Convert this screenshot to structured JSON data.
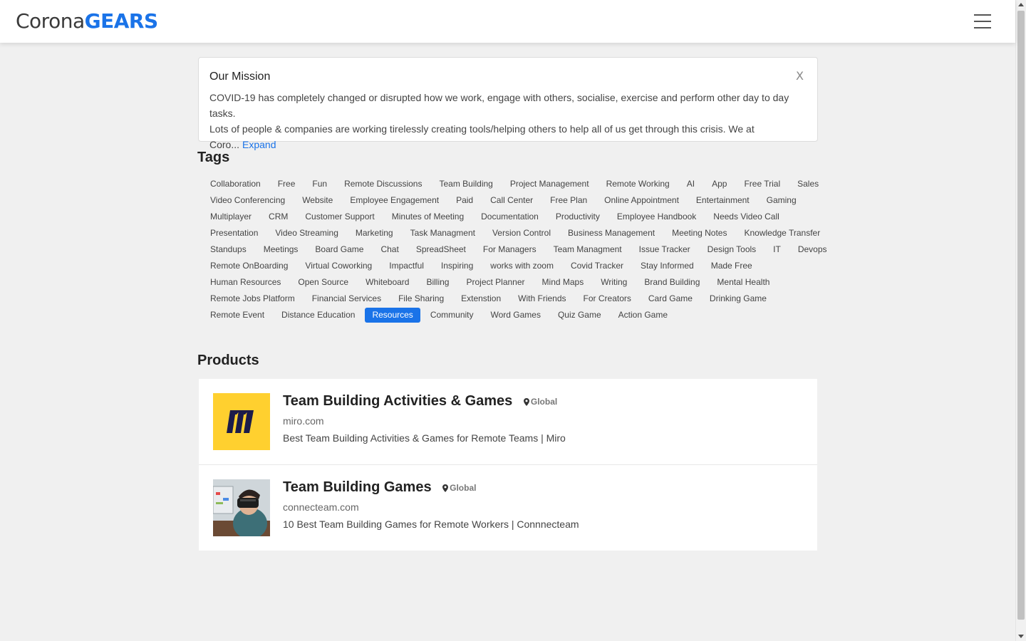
{
  "brand": {
    "part1": "Corona",
    "part2": "GEARS"
  },
  "mission": {
    "title": "Our Mission",
    "close": "X",
    "text_line1": "COVID-19 has completely changed or disrupted how we work, engage with others, socialise, exercise and perform other day to day tasks.",
    "text_line2": "Lots of people & companies are working tirelessly creating tools/helping others to help all of us get through this crisis. We at Coro...",
    "expand": "Expand"
  },
  "tags_heading": "Tags",
  "tag_rows": [
    [
      "Collaboration",
      "Free",
      "Fun",
      "Remote Discussions",
      "Team Building",
      "Project Management",
      "Remote Working",
      "AI",
      "App",
      "Free Trial",
      "Sales"
    ],
    [
      "Video Conferencing",
      "Website",
      "Employee Engagement",
      "Paid",
      "Call Center",
      "Free Plan",
      "Online Appointment",
      "Entertainment",
      "Gaming"
    ],
    [
      "Multiplayer",
      "CRM",
      "Customer Support",
      "Minutes of Meeting",
      "Documentation",
      "Productivity",
      "Employee Handbook",
      "Needs Video Call"
    ],
    [
      "Presentation",
      "Video Streaming",
      "Marketing",
      "Task Managment",
      "Version Control",
      "Business Management",
      "Meeting Notes",
      "Knowledge Transfer"
    ],
    [
      "Standups",
      "Meetings",
      "Board Game",
      "Chat",
      "SpreadSheet",
      "For Managers",
      "Team Managment",
      "Issue Tracker",
      "Design Tools",
      "IT",
      "Devops"
    ],
    [
      "Remote OnBoarding",
      "Virtual Coworking",
      "Impactful",
      "Inspiring",
      "works with zoom",
      "Covid Tracker",
      "Stay Informed",
      "Made Free"
    ],
    [
      "Human Resources",
      "Open Source",
      "Whiteboard",
      "Billing",
      "Project Planner",
      "Mind Maps",
      "Writing",
      "Brand Building",
      "Mental Health"
    ],
    [
      "Remote Jobs Platform",
      "Financial Services",
      "File Sharing",
      "Extenstion",
      "With Friends",
      "For Creators",
      "Card Game",
      "Drinking Game"
    ],
    [
      "Remote Event",
      "Distance Education",
      "Resources",
      "Community",
      "Word Games",
      "Quiz Game",
      "Action Game"
    ]
  ],
  "active_tag": "Resources",
  "products_heading": "Products",
  "products": [
    {
      "title": "Team Building Activities & Games",
      "region": "Global",
      "domain": "miro.com",
      "description": "Best Team Building Activities & Games for Remote Teams | Miro"
    },
    {
      "title": "Team Building Games",
      "region": "Global",
      "domain": "connecteam.com",
      "description": "10 Best Team Building Games for Remote Workers | Connnecteam"
    }
  ],
  "icons": {
    "menu": "hamburger-menu-icon",
    "close": "close-icon",
    "location": "location-pin-icon"
  },
  "colors": {
    "accent": "#1a73e8",
    "miro_yellow": "#ffd02f"
  }
}
